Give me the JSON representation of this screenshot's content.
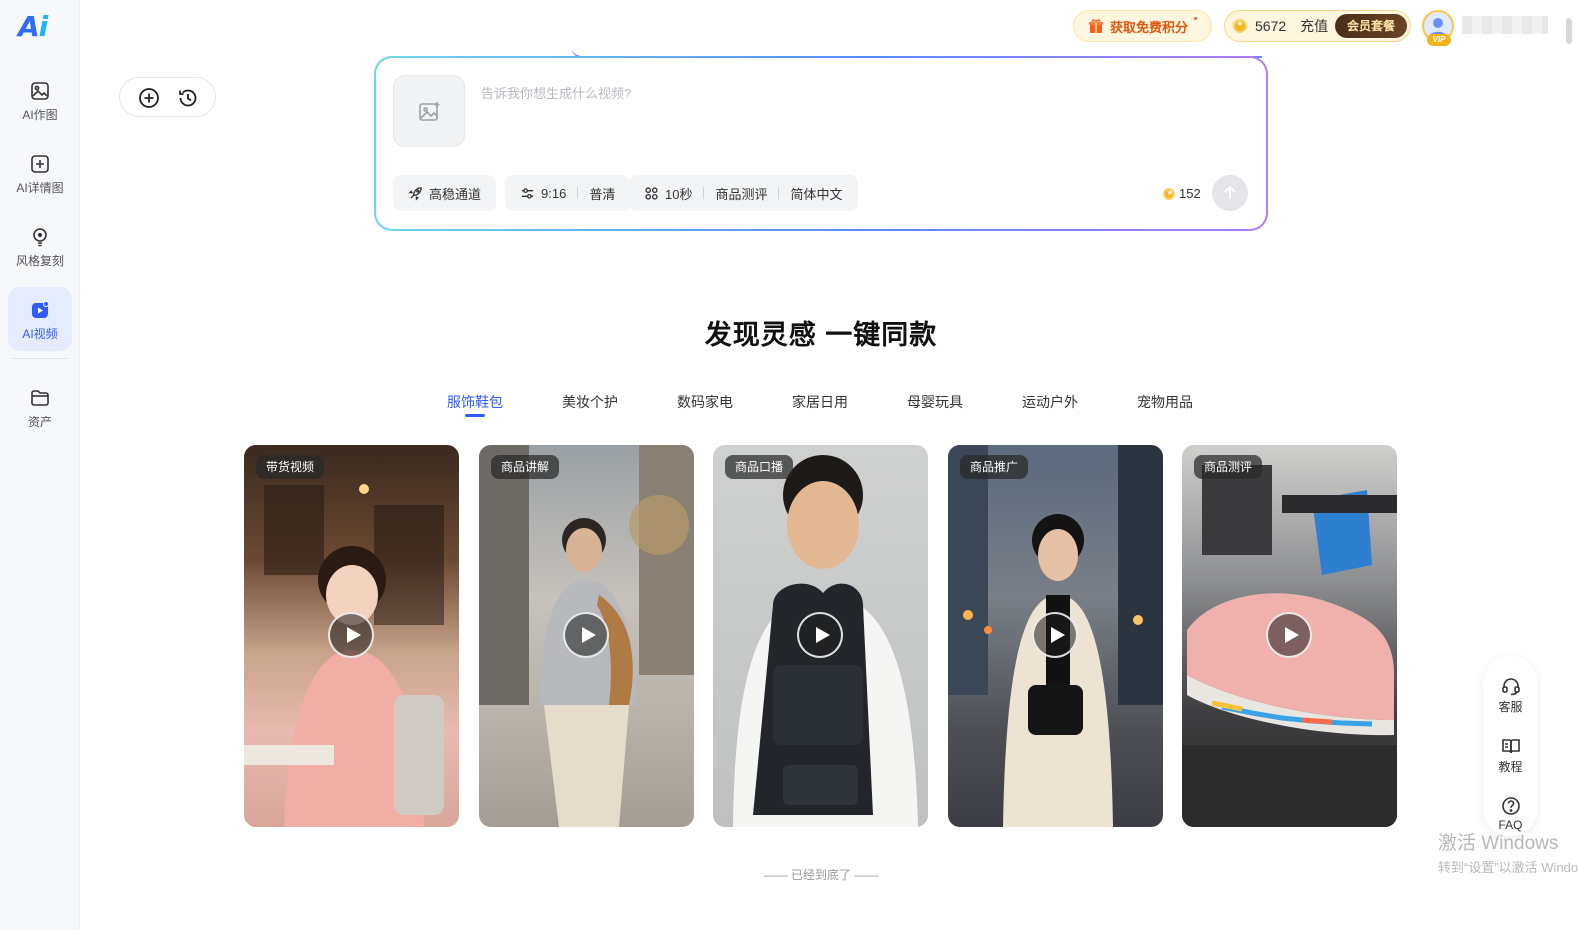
{
  "logo": {
    "text_main": "A",
    "text_accent": "i"
  },
  "sidebar": {
    "items": [
      {
        "label": "AI作图",
        "icon": "image-icon"
      },
      {
        "label": "AI详情图",
        "icon": "plus-square-icon"
      },
      {
        "label": "风格复刻",
        "icon": "lightbulb-icon"
      },
      {
        "label": "AI视频",
        "icon": "video-icon",
        "active": true
      },
      {
        "label": "资产",
        "icon": "folder-icon"
      }
    ]
  },
  "header": {
    "promo_label": "获取免费积分",
    "points": "5672",
    "recharge_label": "充值",
    "member_label": "会员套餐",
    "vip_badge": "VIP"
  },
  "prompt": {
    "placeholder": "告诉我你想生成什么视频?",
    "chips": {
      "channel": "高稳通道",
      "ratio": "9:16",
      "quality": "普清",
      "duration": "10秒",
      "template": "商品测评",
      "language": "简体中文"
    },
    "credits": "152"
  },
  "section": {
    "title": "发现灵感 一键同款",
    "tabs": [
      "服饰鞋包",
      "美妆个护",
      "数码家电",
      "家居日用",
      "母婴玩具",
      "运动户外",
      "宠物用品"
    ],
    "active_tab": "服饰鞋包",
    "cards": [
      {
        "tag": "带货视频"
      },
      {
        "tag": "商品讲解"
      },
      {
        "tag": "商品口播"
      },
      {
        "tag": "商品推广"
      },
      {
        "tag": "商品测评"
      }
    ],
    "end_note": "—— 已经到底了 ——"
  },
  "helper": {
    "service": "客服",
    "tutorial": "教程",
    "faq": "FAQ"
  },
  "watermark": {
    "line1": "激活 Windows",
    "line2": "转到“设置”以激活 Windows。"
  },
  "colors": {
    "accent": "#2f5bff",
    "gold": "#f6b51e",
    "member_bg": "#4a2d18"
  }
}
